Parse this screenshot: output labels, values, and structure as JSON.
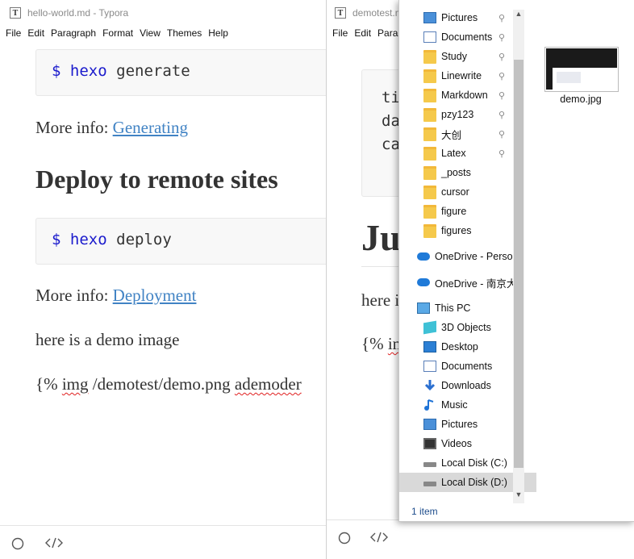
{
  "win1": {
    "title": "hello-world.md - Typora",
    "app_icon_glyph": "T",
    "menu": [
      "File",
      "Edit",
      "Paragraph",
      "Format",
      "View",
      "Themes",
      "Help"
    ],
    "code1": {
      "prompt": "$",
      "cmd": "hexo",
      "arg": "generate"
    },
    "more_info_1": {
      "prefix": "More info: ",
      "link": "Generating"
    },
    "heading": "Deploy to remote sites",
    "code2": {
      "prompt": "$",
      "cmd": "hexo",
      "arg": "deploy"
    },
    "more_info_2": {
      "prefix": "More info: ",
      "link": "Deployment"
    },
    "para_demo": "here is a demo image",
    "tag_line": {
      "p1": "{% ",
      "w1": "img",
      "p2": " /demotest/demo.png ",
      "w2": "ademoder"
    },
    "status_icons": [
      "circle-icon",
      "code-icon"
    ]
  },
  "win2": {
    "title": "demotest.m",
    "app_icon_glyph": "T",
    "menu": [
      "File",
      "Edit",
      "Para"
    ],
    "code_lines": [
      "ti",
      "da",
      "ca"
    ],
    "heading": "Ju",
    "para": "here i",
    "tag_line": {
      "p1": "{% ",
      "w1": "im"
    }
  },
  "explorer": {
    "nav": [
      {
        "label": "Pictures",
        "icon": "pictures-icon",
        "pinned": true
      },
      {
        "label": "Documents",
        "icon": "documents-icon",
        "pinned": true
      },
      {
        "label": "Study",
        "icon": "folder-icon",
        "pinned": true
      },
      {
        "label": "Linewrite",
        "icon": "folder-icon",
        "pinned": true
      },
      {
        "label": "Markdown",
        "icon": "folder-icon",
        "pinned": true
      },
      {
        "label": "pzy123",
        "icon": "folder-icon",
        "pinned": true
      },
      {
        "label": "大创",
        "icon": "folder-icon",
        "pinned": true
      },
      {
        "label": "Latex",
        "icon": "folder-icon",
        "pinned": true
      },
      {
        "label": "_posts",
        "icon": "folder-icon",
        "pinned": false
      },
      {
        "label": "cursor",
        "icon": "folder-icon",
        "pinned": false
      },
      {
        "label": "figure",
        "icon": "folder-icon",
        "pinned": false
      },
      {
        "label": "figures",
        "icon": "folder-icon",
        "pinned": false
      }
    ],
    "onedrive": [
      {
        "label": "OneDrive - Person",
        "icon": "onedrive-icon"
      },
      {
        "label": "OneDrive - 南京大",
        "icon": "onedrive-icon"
      }
    ],
    "this_pc": {
      "label": "This PC",
      "icon": "pc-icon"
    },
    "pc_items": [
      {
        "label": "3D Objects",
        "icon": "3d-objects-icon"
      },
      {
        "label": "Desktop",
        "icon": "desktop-icon"
      },
      {
        "label": "Documents",
        "icon": "documents-icon"
      },
      {
        "label": "Downloads",
        "icon": "downloads-icon"
      },
      {
        "label": "Music",
        "icon": "music-icon"
      },
      {
        "label": "Pictures",
        "icon": "pictures-icon"
      },
      {
        "label": "Videos",
        "icon": "videos-icon"
      },
      {
        "label": "Local Disk (C:)",
        "icon": "local-disk-icon"
      },
      {
        "label": "Local Disk (D:)",
        "icon": "local-disk-icon",
        "selected": true
      }
    ],
    "file": {
      "name": "demo.jpg"
    },
    "status": "1 item"
  }
}
